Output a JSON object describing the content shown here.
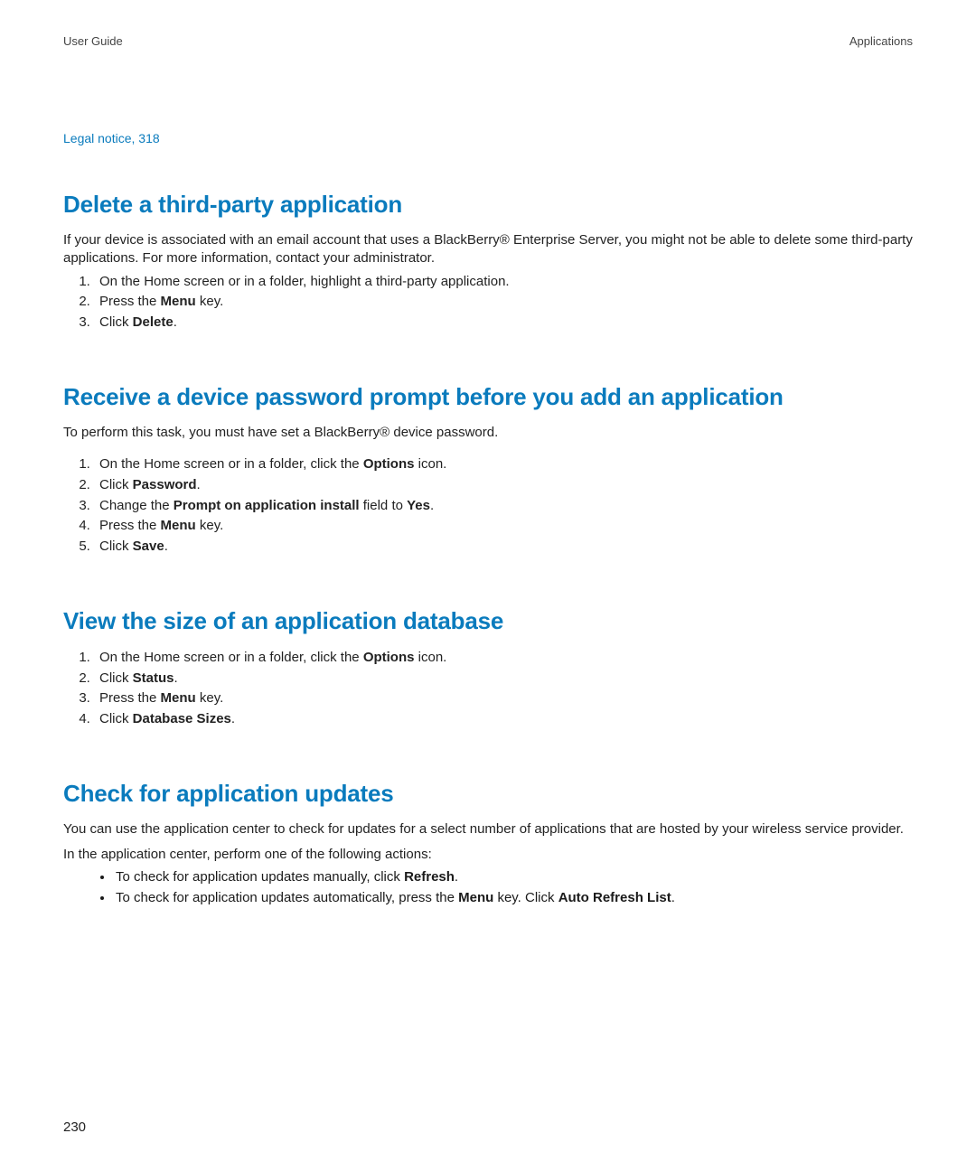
{
  "header": {
    "left": "User Guide",
    "right": "Applications"
  },
  "top_link": "Legal notice, 318",
  "sections": [
    {
      "title": "Delete a third-party application",
      "intro": "If your device is associated with an email account that uses a BlackBerry® Enterprise Server, you might not be able to delete some third-party applications. For more information, contact your administrator.",
      "steps_html": [
        "On the Home screen or in a folder, highlight a third-party application.",
        "Press the <b>Menu</b> key.",
        "Click <b>Delete</b>."
      ]
    },
    {
      "title": "Receive a device password prompt before you add an application",
      "intro": "To perform this task, you must have set a BlackBerry® device password.",
      "steps_html": [
        "On the Home screen or in a folder, click the <b>Options</b> icon.",
        "Click <b>Password</b>.",
        "Change the <b>Prompt on application install</b> field to <b>Yes</b>.",
        "Press the <b>Menu</b> key.",
        "Click <b>Save</b>."
      ]
    },
    {
      "title": "View the size of an application database",
      "intro": "",
      "steps_html": [
        "On the Home screen or in a folder, click the <b>Options</b> icon.",
        "Click <b>Status</b>.",
        "Press the <b>Menu</b> key.",
        "Click <b>Database Sizes</b>."
      ]
    },
    {
      "title": "Check for application updates",
      "intro": "You can use the application center to check for updates for a select number of applications that are hosted by your wireless service provider.",
      "subintro": "In the application center, perform one of the following actions:",
      "bullets_html": [
        "To check for application updates manually, click <b>Refresh</b>.",
        "To check for application updates automatically, press the <b>Menu</b> key. Click <b>Auto Refresh List</b>."
      ]
    }
  ],
  "page_number": "230"
}
